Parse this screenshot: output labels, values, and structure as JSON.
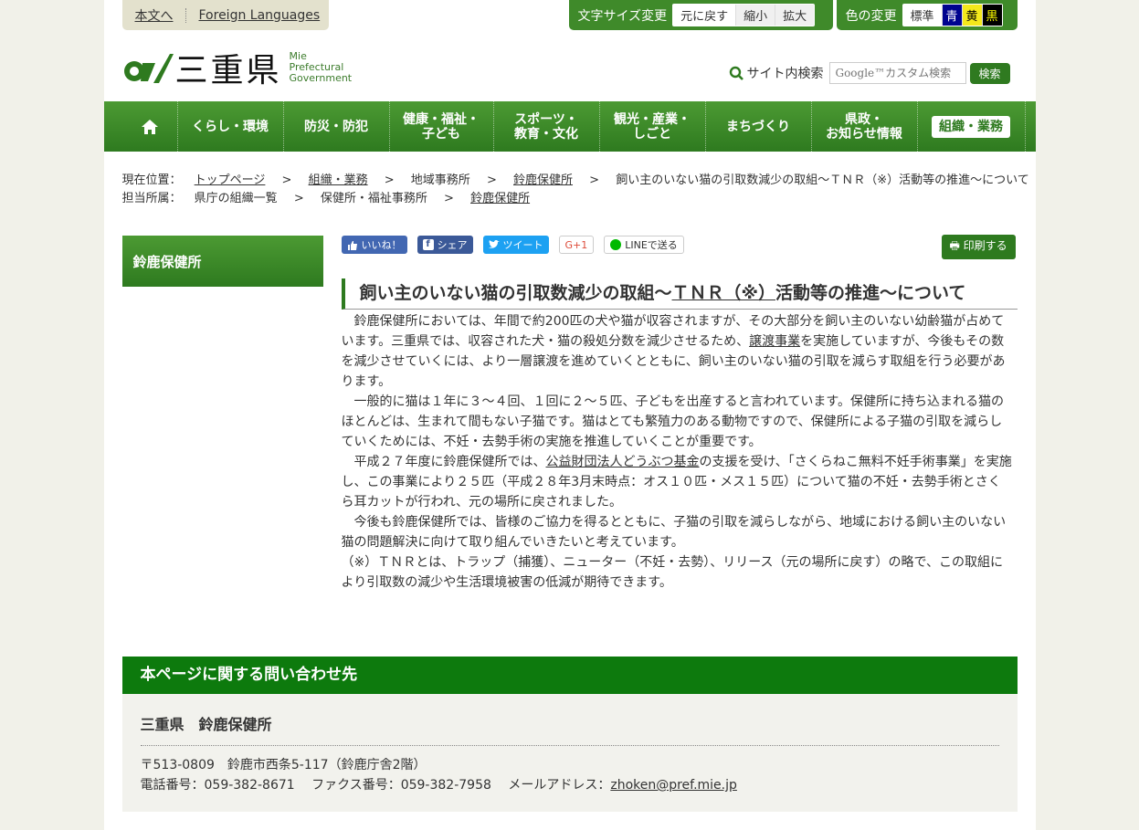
{
  "top": {
    "skip_main": "本文へ",
    "foreign": "Foreign Languages",
    "font_size_label": "文字サイズ変更",
    "font_buttons": [
      "元に戻す",
      "縮小",
      "拡大"
    ],
    "color_label": "色の変更",
    "color_buttons": [
      "標準",
      "青",
      "黄",
      "黒"
    ]
  },
  "logo": {
    "jp": "三重県",
    "en": [
      "Mie",
      "Prefectural",
      "Government"
    ]
  },
  "search": {
    "label": "サイト内検索",
    "placeholder": "Google™カスタム検索",
    "button": "検索"
  },
  "nav": {
    "home_icon": "home-icon",
    "items": [
      "くらし・環境",
      "防災・防犯",
      "健康・福祉・\n子ども",
      "スポーツ・\n教育・文化",
      "観光・産業・\nしごと",
      "まちづくり",
      "県政・\nお知らせ情報",
      "組織・業務"
    ]
  },
  "breadcrumb": {
    "row1_label": "現在位置：",
    "row1": [
      "トップページ",
      "組織・業務",
      "地域事務所",
      "鈴鹿保健所",
      "飼い主のいない猫の引取数減少の取組～ＴＮＲ（※）活動等の推進～について"
    ],
    "row2_label": "担当所属：",
    "row2": [
      "県庁の組織一覧",
      "保健所・福祉事務所",
      "鈴鹿保健所"
    ],
    "separator": ">"
  },
  "sidebar": {
    "title": "鈴鹿保健所"
  },
  "social": {
    "like": "いいね！",
    "share": "シェア",
    "tweet": "ツイート",
    "gplus": "G+1",
    "line": "LINEで送る",
    "print": "印刷する"
  },
  "article": {
    "title_pre": "飼い主のいない猫の引取数減少の取組～",
    "title_link": "ＴＮＲ（※）",
    "title_post": "活動等の推進～について",
    "p1_a": "　鈴鹿保健所においては、年間で約200匹の犬や猫が収容されますが、その大部分を飼い主のいない幼齢猫が占めています。三重県では、収容された犬・猫の殺処分数を減少させるため、",
    "p1_link": "譲渡事業",
    "p1_b": "を実施していますが、今後もその数を減少させていくには、より一層譲渡を進めていくとともに、飼い主のいない猫の引取を減らす取組を行う必要があります。",
    "p2": "　一般的に猫は１年に３～４回、１回に２～５匹、子どもを出産すると言われています。保健所に持ち込まれる猫のほとんどは、生まれて間もない子猫です。猫はとても繁殖力のある動物ですので、保健所による子猫の引取を減らしていくためには、不妊・去勢手術の実施を推進していくことが重要です。",
    "p3_a": "　平成２７年度に鈴鹿保健所では、",
    "p3_link": "公益財団法人どうぶつ基金",
    "p3_b": "の支援を受け、「さくらねこ無料不妊手術事業」を実施し、この事業により２５匹（平成２８年3月末時点：オス１０匹・メス１５匹）について猫の不妊・去勢手術とさくら耳カットが行われ、元の場所に戻されました。",
    "p4": "　今後も鈴鹿保健所では、皆様のご協力を得るとともに、子猫の引取を減らしながら、地域における飼い主のいない猫の問題解決に向けて取り組んでいきたいと考えています。",
    "p5": "（※）ＴＮＲとは、トラップ（捕獲）、ニューター（不妊・去勢）、リリース（元の場所に戻す）の略で、この取組により引取数の減少や生活環境被害の低減が期待できます。"
  },
  "contact": {
    "heading": "本ページに関する問い合わせ先",
    "org": "三重県　鈴鹿保健所",
    "address": "〒513-0809　鈴鹿市西条5-117（鈴鹿庁舎2階）",
    "tel": "電話番号：059-382-8671　 ファクス番号：059-382-7958　 メールアドレス：",
    "email": "zhoken@pref.mie.jp"
  },
  "colors": {
    "brand_green": "#2e7a1f",
    "contact_green": "#0d7a0d"
  }
}
